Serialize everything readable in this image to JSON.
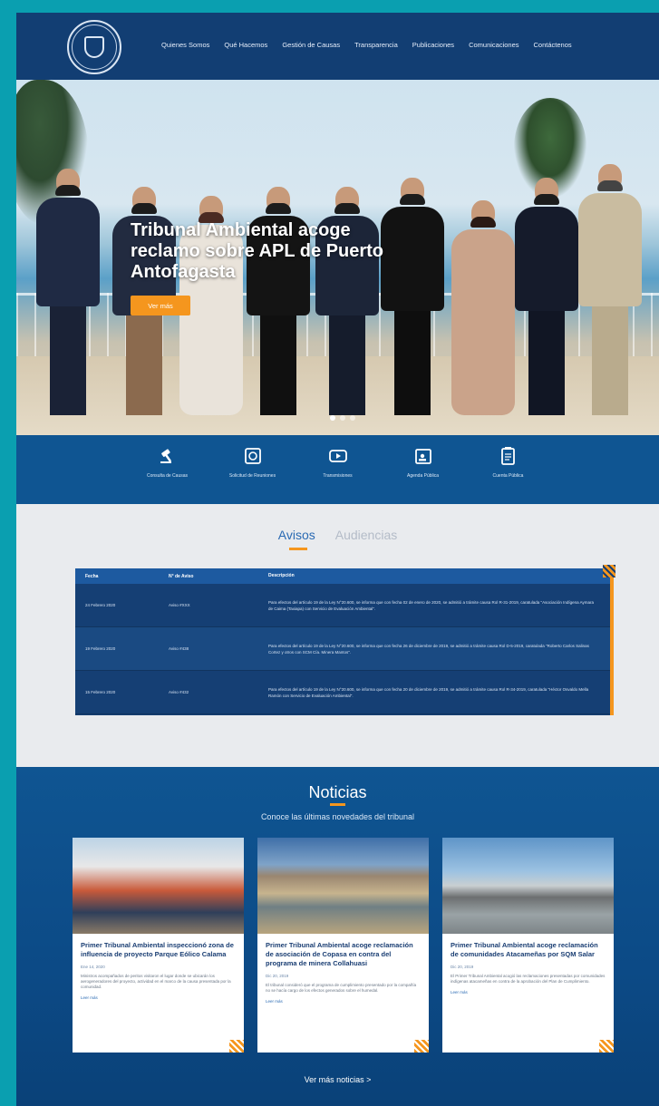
{
  "header": {
    "nav": [
      "Quienes Somos",
      "Qué Hacemos",
      "Gestión de Causas",
      "Transparencia",
      "Publicaciones",
      "Comunicaciones",
      "Contáctenos"
    ]
  },
  "hero": {
    "title": "Tribunal Ambiental acoge reclamo sobre APL de Puerto Antofagasta",
    "button": "Ver más",
    "slides": 3,
    "active_slide": 1
  },
  "quick_links": [
    {
      "label": "Consulta de Causas",
      "icon": "gavel-icon"
    },
    {
      "label": "Solicitud de Reuniones",
      "icon": "request-icon"
    },
    {
      "label": "Transmisiones",
      "icon": "play-icon"
    },
    {
      "label": "Agenda Pública",
      "icon": "calendar-icon"
    },
    {
      "label": "Cuenta Pública",
      "icon": "document-icon"
    }
  ],
  "tabs": {
    "active": "Avisos",
    "inactive": "Audiencias"
  },
  "table": {
    "headers": [
      "Fecha",
      "N° de Aviso",
      "Descripción"
    ],
    "rows": [
      {
        "date": "24 Febrero 2020",
        "aviso": "Aviso #XXX",
        "description": "Para efectos del artículo 19 de la Ley N°20.600, se informa que con fecha 02 de enero de 2020, se admitió a trámite causa Rol R-31-2019, caratulada \"Asociación Indígena Aymara de Caima (Taxiapa) con Servicio de Evaluación Ambiental\"."
      },
      {
        "date": "19 Febrero 2020",
        "aviso": "Aviso #438",
        "description": "Para efectos del artículo 19 de la Ley N°20.600, se informa que con fecha 26 de diciembre de 2019, se admitió a trámite causa Rol D-5-2019, caratulada \"Roberto Carlos Salinas Cortez y otros con SCM Cía. Minera Mantos\"."
      },
      {
        "date": "15 Febrero 2020",
        "aviso": "Aviso #432",
        "description": "Para efectos del artículo 19 de la Ley N°20.600, se informa que con fecha 20 de diciembre de 2019, se admitió a trámite causa Rol R-34-2019, caratulada \"Héctor Osvaldo Mella Ramón con Servicio de Evaluación Ambiental\"."
      }
    ]
  },
  "news": {
    "title": "Noticias",
    "subtitle": "Conoce las últimas novedades del tribunal",
    "more": "Ver más noticias >",
    "cards": [
      {
        "title": "Primer Tribunal Ambiental inspeccionó zona de influencia de proyecto Parque Eólico Calama",
        "date": "Ene 14, 2020",
        "text": "Ministros acompañados de peritos visitaron el lugar donde se ubicarán los aerogeneradores del proyecto, actividad en el marco de la causa presentada por la comunidad.",
        "more": "Leer más"
      },
      {
        "title": "Primer Tribunal Ambiental acoge reclamación de asociación de Copasa en contra del programa de minera Collahuasi",
        "date": "Dic 20, 2019",
        "text": "El tribunal consideró que el programa de cumplimiento presentado por la compañía no se hacía cargo de los efectos generados sobre el humedal.",
        "more": "Leer más"
      },
      {
        "title": "Primer Tribunal Ambiental acoge reclamación de comunidades Atacameñas por SQM Salar",
        "date": "Dic 20, 2019",
        "text": "El Primer Tribunal Ambiental acogió las reclamaciones presentadas por comunidades indígenas atacameñas en contra de la aprobación del Plan de Cumplimiento.",
        "more": "Leer más"
      }
    ]
  },
  "colors": {
    "header": "#123e73",
    "accent": "#f5961e",
    "band": "#0f5592",
    "page_border": "#0a9fb0"
  }
}
